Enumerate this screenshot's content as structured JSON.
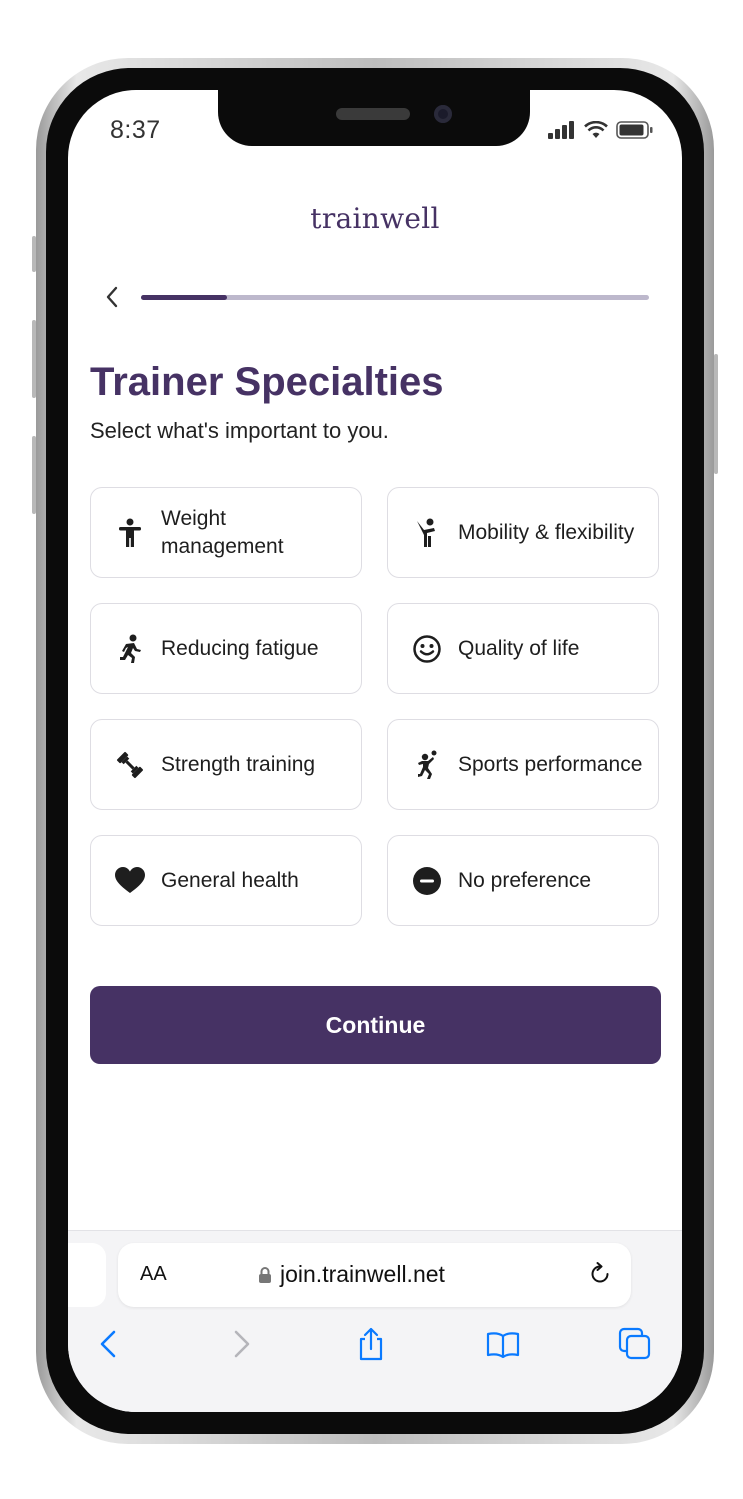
{
  "status_bar": {
    "time": "8:37"
  },
  "brand": "trainwell",
  "progress": {
    "fraction": 0.17
  },
  "title": "Trainer Specialties",
  "subtitle": "Select what's important to you.",
  "options": [
    {
      "label": "Weight management",
      "icon": "person-standing-icon"
    },
    {
      "label": "Mobility & flexibility",
      "icon": "person-stretch-icon"
    },
    {
      "label": "Reducing fatigue",
      "icon": "person-running-icon"
    },
    {
      "label": "Quality of life",
      "icon": "smiley-face-icon"
    },
    {
      "label": "Strength training",
      "icon": "dumbbell-icon"
    },
    {
      "label": "Sports performance",
      "icon": "person-sports-icon"
    },
    {
      "label": "General health",
      "icon": "heart-icon"
    },
    {
      "label": "No preference",
      "icon": "minus-circle-icon"
    }
  ],
  "continue_label": "Continue",
  "browser": {
    "aa_label": "AA",
    "url": "join.trainwell.net"
  },
  "colors": {
    "accent": "#463264",
    "progress_track": "#bdb8cc",
    "ios_blue": "#0a7aff"
  }
}
